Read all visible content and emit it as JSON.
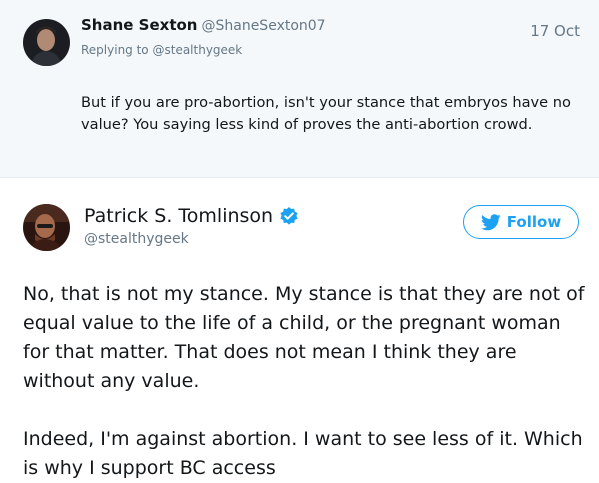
{
  "reply_tweet": {
    "author_name": "Shane Sexton",
    "author_handle": "@ShaneSexton07",
    "date": "17 Oct",
    "replying_to_prefix": "Replying to",
    "replying_to_handle": "@stealthygeek",
    "text": "But if you are pro-abortion, isn't your stance that embryos have no value? You saying less kind of proves the anti-abortion crowd."
  },
  "main_tweet": {
    "author_name": "Patrick S. Tomlinson",
    "author_handle": "@stealthygeek",
    "verified_icon": "verified-badge-icon",
    "follow_label": "Follow",
    "follow_icon": "twitter-bird-icon",
    "paragraphs": [
      "No, that is not my stance. My stance is that they are not of equal value to the life of a child, or the pregnant woman for that matter. That does not mean I think they are without any value.",
      "Indeed, I'm against abortion. I want to see less of it. Which is why I support BC access"
    ]
  },
  "colors": {
    "accent": "#1da1f2",
    "muted": "#657786",
    "reply_background": "#f5f8fa"
  }
}
